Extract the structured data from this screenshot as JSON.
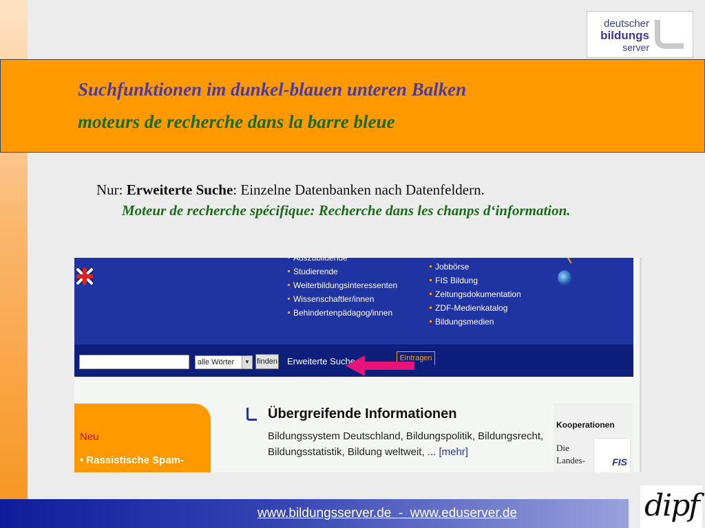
{
  "logo": {
    "line1": "deutscher",
    "line2": "bildungs",
    "line3": "server"
  },
  "title": {
    "german": "Suchfunktionen im dunkel-blauen unteren Balken",
    "french": "moteurs de recherche dans la barre bleue"
  },
  "body": {
    "prefix": "Nur: ",
    "bold": "Erweiterte Suche",
    "rest": ": Einzelne Datenbanken nach Datenfeldern.",
    "french": "Moteur de recherche spécifique: Recherche dans les chanps d‘information."
  },
  "screenshot": {
    "nav_col1": [
      "Auszubildende",
      "Studierende",
      "Weiterbildungsinteressenten",
      "Wissenschaftler/innen",
      "Behindertenpädagog/innen"
    ],
    "nav_col2": [
      "Jobbörse",
      "FIS Bildung",
      "Zeitungsdokumentation",
      "ZDF-Medienkatalog",
      "Bildungsmedien"
    ],
    "search": {
      "input_value": "",
      "select_value": "alle Wörter",
      "find_button": "finden",
      "extended_search": "Erweiterte Suche",
      "eintragen": "Eintragen"
    },
    "neu": {
      "title": "Neu",
      "item": "Rassistische Spam-"
    },
    "info": {
      "title": "Übergreifende Informationen",
      "line1": "Bildungssystem Deutschland, Bildungspolitik, Bildungsrecht,",
      "line2": "Bildungsstatistik, Bildung weltweit, ...",
      "more": "[mehr]"
    },
    "kooperationen": {
      "title": "Kooperationen",
      "line1": "Die",
      "line2": "Landes-",
      "fis": "FIS"
    }
  },
  "footer": {
    "urls": "www.bildungsserver.de  -  www.eduserver.de",
    "dipf": "dipf"
  },
  "colors": {
    "orange": "#ff9900",
    "blue": "#1f33a3",
    "dark_blue": "#0d1e7b",
    "arrow": "#e8137a"
  }
}
